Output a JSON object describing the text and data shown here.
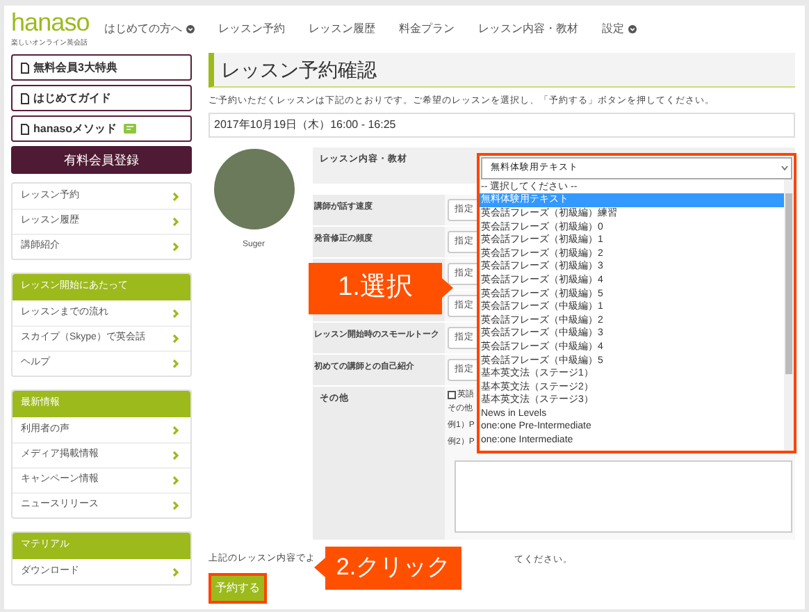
{
  "header": {
    "logo": "hanaso",
    "tagline": "楽しいオンライン英会話",
    "nav": [
      {
        "label": "はじめての方へ",
        "has_menu": true
      },
      {
        "label": "レッスン予約",
        "has_menu": false
      },
      {
        "label": "レッスン履歴",
        "has_menu": false
      },
      {
        "label": "料金プラン",
        "has_menu": false
      },
      {
        "label": "レッスン内容・教材",
        "has_menu": false
      },
      {
        "label": "設定",
        "has_menu": true
      }
    ]
  },
  "sidebar": {
    "links": [
      {
        "label": "無料会員3大特典",
        "badge": false
      },
      {
        "label": "はじめてガイド",
        "badge": false
      },
      {
        "label": "hanasoメソッド",
        "badge": true
      }
    ],
    "signup_button": "有料会員登録",
    "sections": [
      {
        "items": [
          "レッスン予約",
          "レッスン履歴",
          "講師紹介"
        ]
      },
      {
        "heading": "レッスン開始にあたって",
        "items": [
          "レッスンまでの流れ",
          "スカイプ（Skype）で英会話",
          "ヘルプ"
        ]
      },
      {
        "heading": "最新情報",
        "items": [
          "利用者の声",
          "メディア掲載情報",
          "キャンペーン情報",
          "ニュースリリース"
        ]
      },
      {
        "heading": "マテリアル",
        "items": [
          "ダウンロード"
        ]
      }
    ]
  },
  "main": {
    "title": "レッスン予約確認",
    "intro": "ご予約いただくレッスンは下記のとおりです。ご希望のレッスンを選択し、「予約する」ボタンを押してください。",
    "date": "2017年10月19日（木）16:00 - 16:25",
    "teacher": {
      "name": "Suger"
    },
    "material": {
      "label": "レッスン内容・教材",
      "value": "無料体験用テキスト",
      "options": [
        {
          "label": "-- 選択してください --",
          "selected": false
        },
        {
          "label": "無料体験用テキスト",
          "selected": true
        },
        {
          "label": "英会話フレーズ（初級編）練習",
          "selected": false
        },
        {
          "label": "英会話フレーズ（初級編）0",
          "selected": false
        },
        {
          "label": "英会話フレーズ（初級編）1",
          "selected": false
        },
        {
          "label": "英会話フレーズ（初級編）2",
          "selected": false
        },
        {
          "label": "英会話フレーズ（初級編）3",
          "selected": false
        },
        {
          "label": "英会話フレーズ（初級編）4",
          "selected": false
        },
        {
          "label": "英会話フレーズ（初級編）5",
          "selected": false
        },
        {
          "label": "英会話フレーズ（中級編）1",
          "selected": false
        },
        {
          "label": "英会話フレーズ（中級編）2",
          "selected": false
        },
        {
          "label": "英会話フレーズ（中級編）3",
          "selected": false
        },
        {
          "label": "英会話フレーズ（中級編）4",
          "selected": false
        },
        {
          "label": "英会話フレーズ（中級編）5",
          "selected": false
        },
        {
          "label": "基本英文法（ステージ1）",
          "selected": false
        },
        {
          "label": "基本英文法（ステージ2）",
          "selected": false
        },
        {
          "label": "基本英文法（ステージ3）",
          "selected": false
        },
        {
          "label": "News in Levels",
          "selected": false
        },
        {
          "label": "one:one Pre-Intermediate",
          "selected": false
        },
        {
          "label": "one:one Intermediate",
          "selected": false
        }
      ]
    },
    "rows": [
      {
        "label": "講師が話す速度",
        "value": "指定"
      },
      {
        "label": "発音修正の頻度",
        "value": "指定"
      },
      {
        "value": "指定"
      },
      {
        "value": "指定"
      },
      {
        "label": "レッスン開始時のスモールトーク",
        "value": "指定"
      },
      {
        "label": "初めての講師との自己紹介",
        "value": "指定"
      }
    ],
    "other": {
      "label": "その他",
      "checkbox_label": "英語",
      "checked": false,
      "lines": [
        "その他",
        "例1）P",
        "例2）P"
      ]
    },
    "note_left": "上記のレッスン内容でよ",
    "note_right": "てください。",
    "submit": "予約する"
  },
  "callouts": [
    {
      "text": "1.選択"
    },
    {
      "text": "2.クリック"
    }
  ]
}
